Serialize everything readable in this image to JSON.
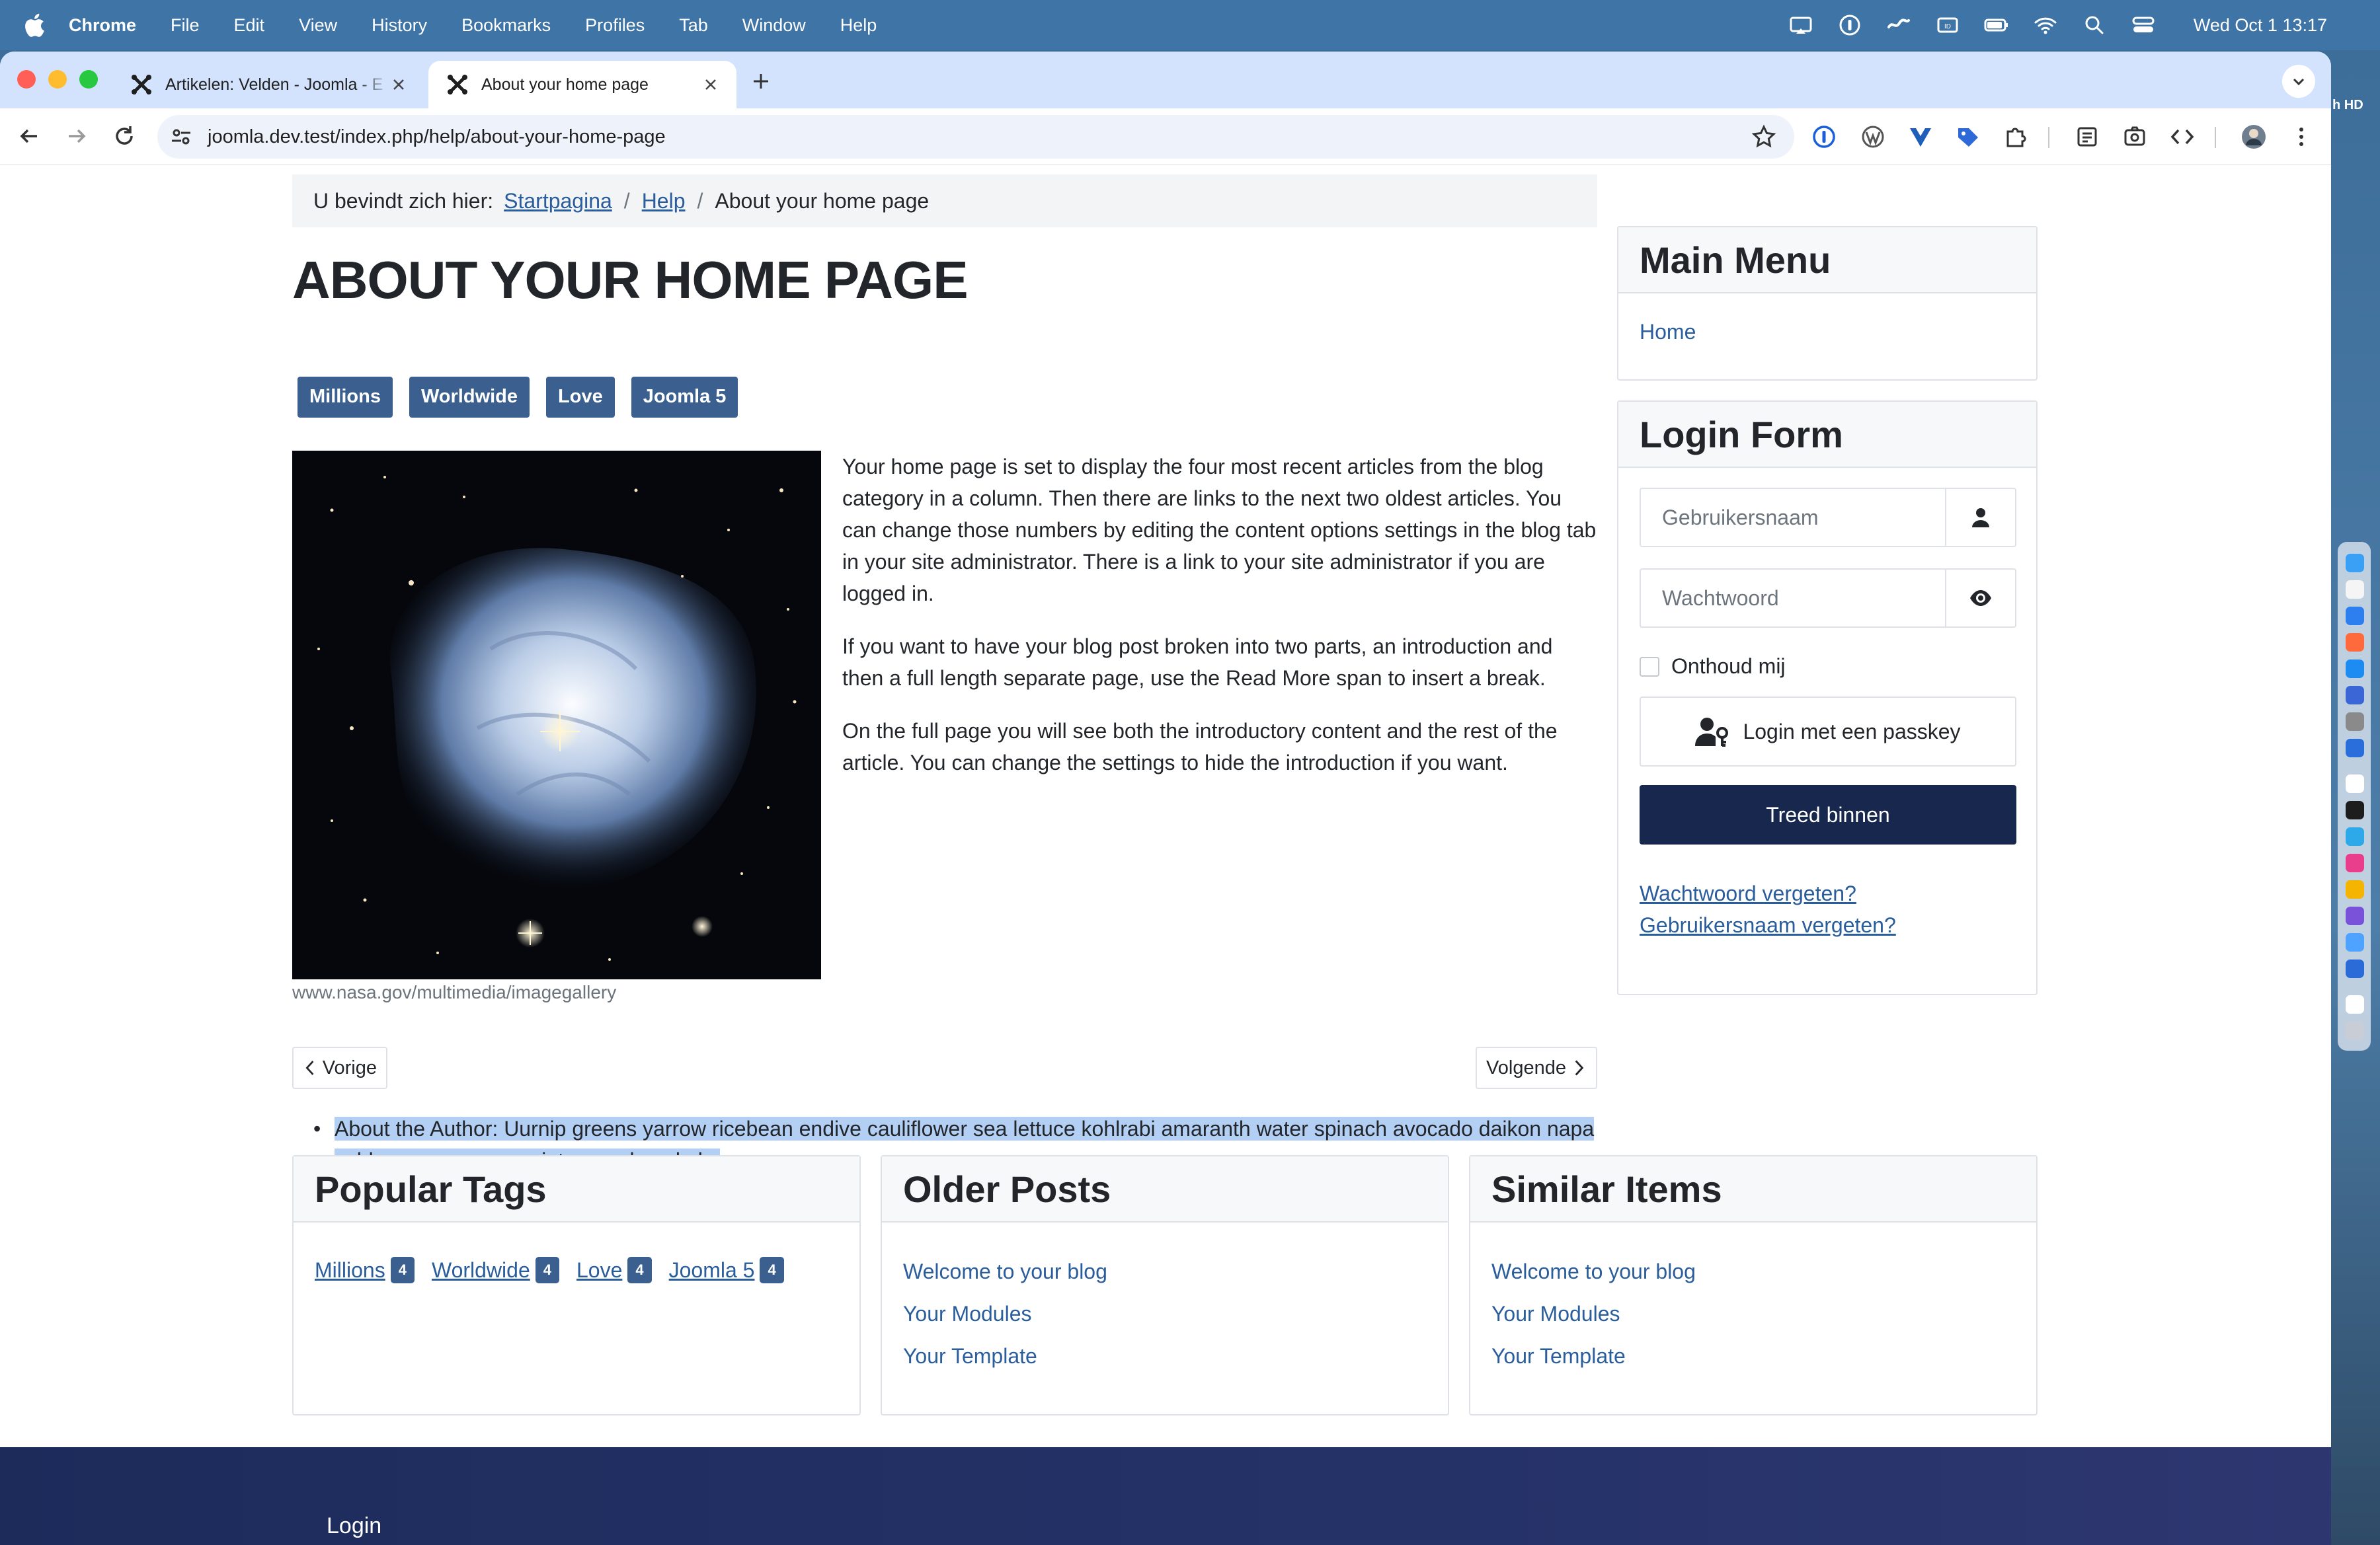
{
  "menubar": {
    "app_name": "Chrome",
    "items": [
      "File",
      "Edit",
      "View",
      "History",
      "Bookmarks",
      "Profiles",
      "Tab",
      "Window",
      "Help"
    ],
    "clock": "Wed Oct 1  13:17",
    "status_icons": [
      "screen-mirroring-icon",
      "password-icon",
      "link-icon",
      "id-icon",
      "battery-icon",
      "wifi-icon",
      "search-icon",
      "control-center-icon"
    ]
  },
  "browser": {
    "tabs": [
      {
        "title": "Artikelen: Velden - Joomla - E",
        "active": false
      },
      {
        "title": "About your home page",
        "active": true
      }
    ],
    "url": "joomla.dev.test/index.php/help/about-your-home-page"
  },
  "breadcrumb": {
    "label": "U bevindt zich hier:",
    "items": [
      "Startpagina",
      "Help",
      "About your home page"
    ]
  },
  "article": {
    "title": "ABOUT YOUR HOME PAGE",
    "tags": [
      "Millions",
      "Worldwide",
      "Love",
      "Joomla 5"
    ],
    "image_caption": "www.nasa.gov/multimedia/imagegallery",
    "paragraphs": [
      "Your home page is set to display the four most recent articles from the blog category in a column. Then there are links to the next two oldest articles. You can change those numbers by editing the content options settings in the blog tab in your site administrator. There is a link to your site administrator if you are logged in.",
      "If you want to have your blog post broken into two parts, an introduction and then a full length separate page, use the Read More span to insert a break.",
      "On the full page you will see both the introductory content and the rest of the article. You can change the settings to hide the introduction if you want."
    ],
    "prev_label": "Vorige",
    "next_label": "Volgende",
    "author": "About the Author: Uurnip greens yarrow ricebean endive cauliflower sea lettuce kohlrabi amaranth water spinach avocado daikon napa cabbage asparagus winter purslane kale."
  },
  "main_menu": {
    "title": "Main Menu",
    "items": [
      "Home"
    ]
  },
  "login_form": {
    "title": "Login Form",
    "username_placeholder": "Gebruikersnaam",
    "password_placeholder": "Wachtwoord",
    "remember_label": "Onthoud mij",
    "passkey_label": "Login met een passkey",
    "submit_label": "Treed binnen",
    "forgot_password": "Wachtwoord vergeten?",
    "forgot_username": "Gebruikersnaam vergeten?"
  },
  "popular_tags": {
    "title": "Popular Tags",
    "tags": [
      {
        "name": "Millions",
        "count": "4"
      },
      {
        "name": "Worldwide",
        "count": "4"
      },
      {
        "name": "Love",
        "count": "4"
      },
      {
        "name": "Joomla 5",
        "count": "4"
      }
    ]
  },
  "older_posts": {
    "title": "Older Posts",
    "items": [
      "Welcome to your blog",
      "Your Modules",
      "Your Template"
    ]
  },
  "similar_items": {
    "title": "Similar Items",
    "items": [
      "Welcome to your blog",
      "Your Modules",
      "Your Template"
    ]
  },
  "footer": {
    "link": "Login"
  },
  "desktop": {
    "edge_label": "h HD"
  },
  "colors": {
    "accent": "#3b5f8f",
    "link": "#2a5d9b",
    "primary_button": "#18274d",
    "footer": "#1d2b5b",
    "selection": "#b3cff3"
  }
}
